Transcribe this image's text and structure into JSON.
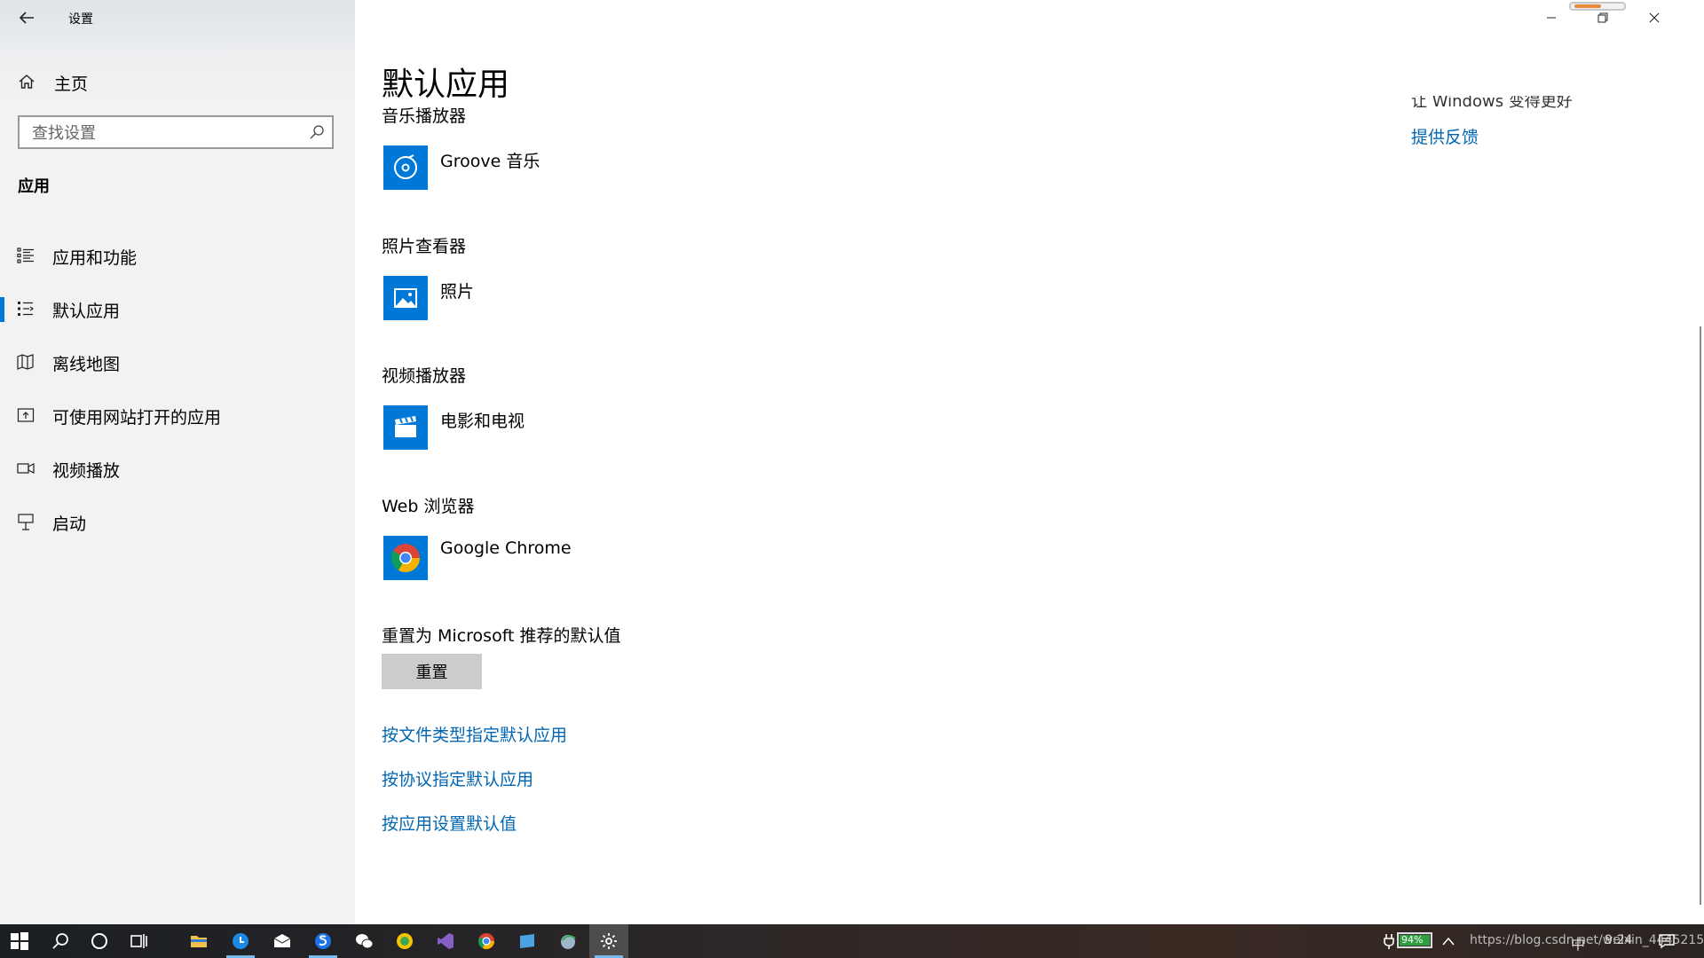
{
  "window": {
    "title": "设置",
    "controls": [
      "minimize",
      "restore",
      "close"
    ]
  },
  "sidebar": {
    "home_label": "主页",
    "search_placeholder": "查找设置",
    "section_title": "应用",
    "items": [
      {
        "label": "应用和功能",
        "icon": "list-icon"
      },
      {
        "label": "默认应用",
        "icon": "default-apps-icon",
        "active": true
      },
      {
        "label": "离线地图",
        "icon": "map-icon"
      },
      {
        "label": "可使用网站打开的应用",
        "icon": "open-website-icon"
      },
      {
        "label": "视频播放",
        "icon": "video-icon"
      },
      {
        "label": "启动",
        "icon": "startup-icon"
      }
    ]
  },
  "main": {
    "title": "默认应用",
    "categories": [
      {
        "label": "音乐播放器",
        "app": "Groove 音乐",
        "icon": "groove-music-icon"
      },
      {
        "label": "照片查看器",
        "app": "照片",
        "icon": "photos-icon"
      },
      {
        "label": "视频播放器",
        "app": "电影和电视",
        "icon": "movies-tv-icon"
      },
      {
        "label": "Web 浏览器",
        "app": "Google Chrome",
        "icon": "chrome-icon"
      }
    ],
    "reset_label": "重置为 Microsoft 推荐的默认值",
    "reset_button": "重置",
    "links": [
      "按文件类型指定默认应用",
      "按协议指定默认应用",
      "按应用设置默认值"
    ]
  },
  "right": {
    "clipped_text": "让 Windows 变得更好",
    "feedback_link": "提供反馈"
  },
  "taskbar": {
    "battery_percent": "94%",
    "input_method": "中",
    "time": "9:24",
    "watermark": "https://blog.csdn.net/weixin_44452150"
  },
  "colors": {
    "accent": "#0078d7",
    "link": "#0066b4",
    "sidebar_bg": "#f2f2f2",
    "button_bg": "#cccccc"
  }
}
